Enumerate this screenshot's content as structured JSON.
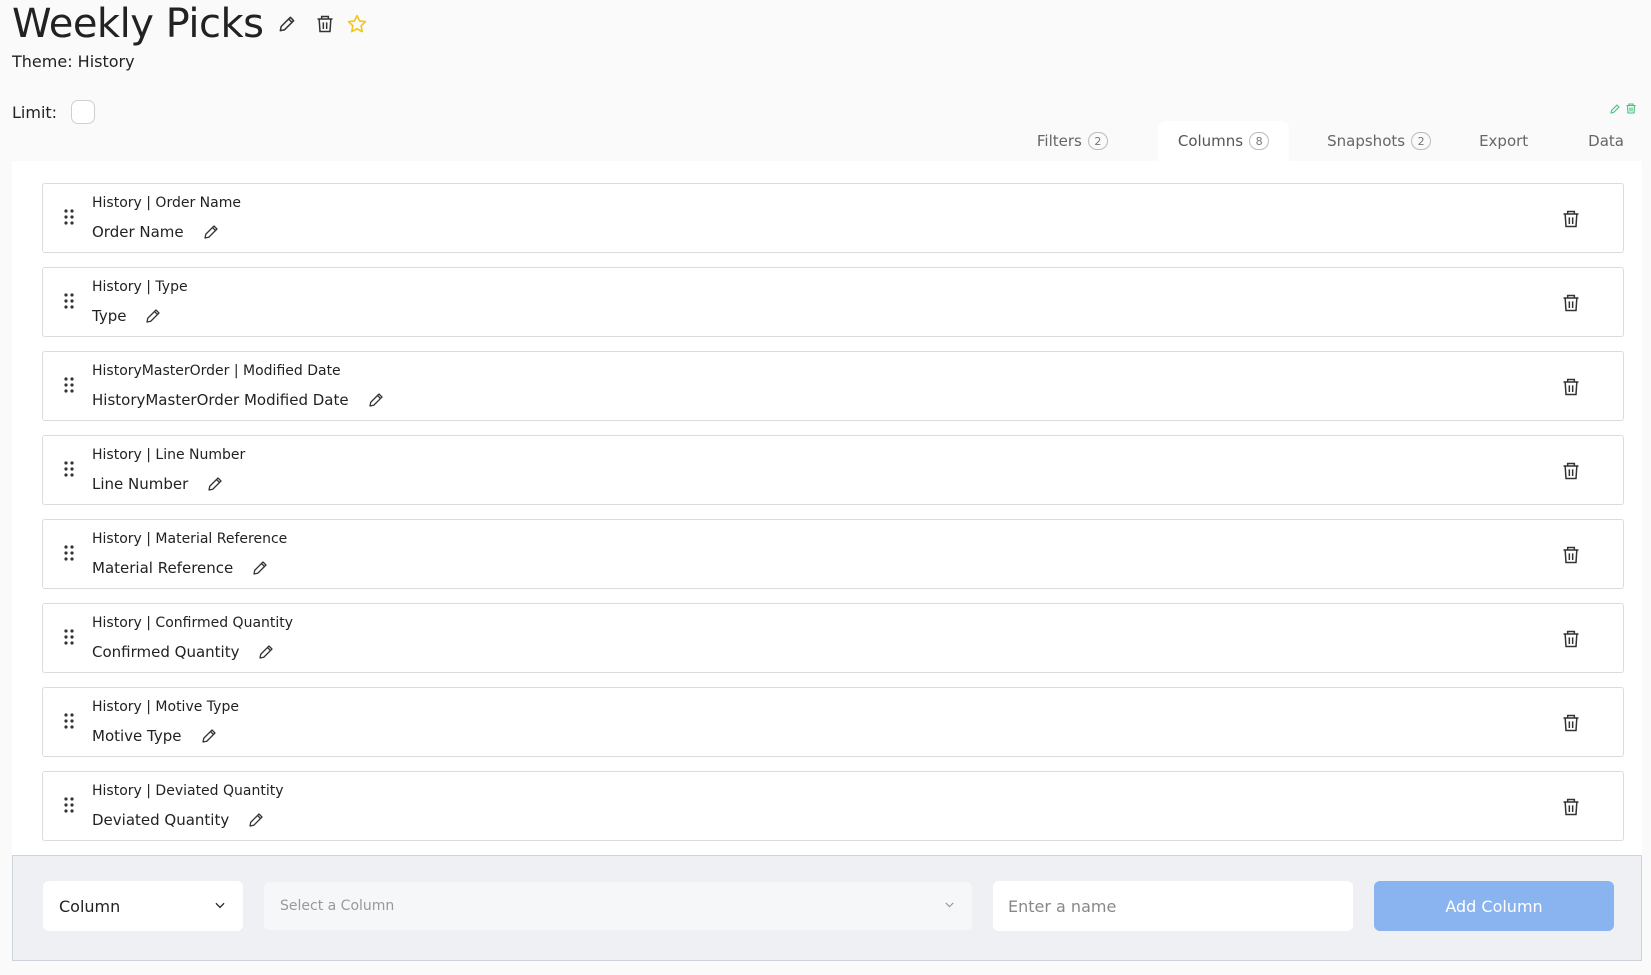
{
  "header": {
    "title": "Weekly Picks",
    "theme": "Theme: History",
    "limit_label": "Limit:",
    "icons": [
      "pencil-icon",
      "trash-icon",
      "star-icon"
    ]
  },
  "tabs": [
    {
      "label": "Filters",
      "count": "2"
    },
    {
      "label": "Columns",
      "count": "8",
      "active": true
    },
    {
      "label": "Snapshots",
      "count": "2"
    },
    {
      "label": "Export"
    },
    {
      "label": "Data"
    }
  ],
  "columns": [
    {
      "path": "History | Order Name",
      "name": "Order Name"
    },
    {
      "path": "History | Type",
      "name": "Type"
    },
    {
      "path": "HistoryMasterOrder | Modified Date",
      "name": "HistoryMasterOrder Modified Date"
    },
    {
      "path": "History | Line Number",
      "name": "Line Number"
    },
    {
      "path": "History | Material Reference",
      "name": "Material Reference"
    },
    {
      "path": "History | Confirmed Quantity",
      "name": "Confirmed Quantity"
    },
    {
      "path": "History | Motive Type",
      "name": "Motive Type"
    },
    {
      "path": "History | Deviated Quantity",
      "name": "Deviated Quantity"
    }
  ],
  "footer": {
    "type_select_value": "Column",
    "column_select_placeholder": "Select a Column",
    "name_placeholder": "Enter a name",
    "add_button": "Add Column"
  },
  "colors": {
    "accent_button": "#8ab4f0",
    "star": "#f5c518",
    "mini_icons": "#3ec47a"
  }
}
